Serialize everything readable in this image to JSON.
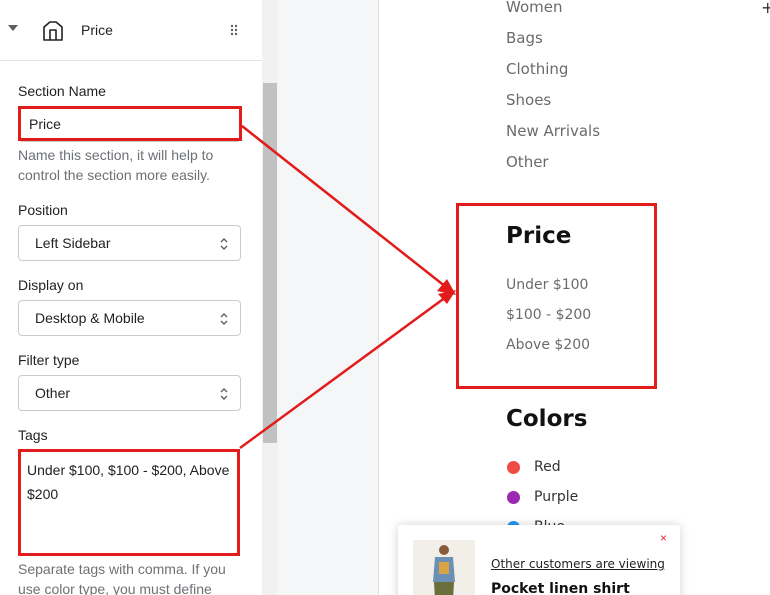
{
  "panel": {
    "title": "Price",
    "section_name": {
      "label": "Section Name",
      "value": "Price",
      "help": "Name this section, it will help to control the section more easily."
    },
    "position": {
      "label": "Position",
      "value": "Left Sidebar"
    },
    "display_on": {
      "label": "Display on",
      "value": "Desktop & Mobile"
    },
    "filter_type": {
      "label": "Filter type",
      "value": "Other"
    },
    "tags": {
      "label": "Tags",
      "value": "Under $100, $100 - $200, Above $200",
      "help": "Separate tags with comma. If you use color type, you must define"
    }
  },
  "preview": {
    "categories": [
      "Women",
      "Bags",
      "Clothing",
      "Shoes",
      "New Arrivals",
      "Other"
    ],
    "expand_symbol": "+",
    "price": {
      "title": "Price",
      "items": [
        "Under $100",
        "$100 - $200",
        "Above $200"
      ]
    },
    "colors": {
      "title": "Colors",
      "items": [
        {
          "name": "Red",
          "color": "#ef4c45"
        },
        {
          "name": "Purple",
          "color": "#9c27b0"
        },
        {
          "name": "Blue",
          "color": "#2196f3"
        }
      ]
    }
  },
  "toast": {
    "viewing_text": "Other customers are viewing",
    "product_name": "Pocket linen shirt",
    "close_symbol": "×"
  },
  "annotation_color": "#e21b1b"
}
